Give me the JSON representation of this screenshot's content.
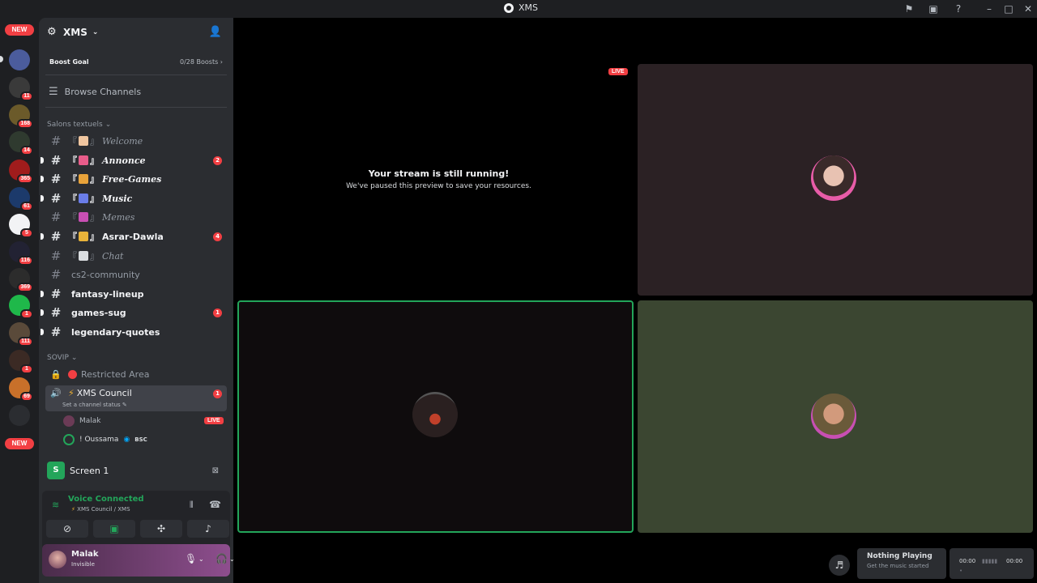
{
  "window": {
    "title": "XMS"
  },
  "rail": {
    "new_top": "NEW",
    "new_bottom": "NEW",
    "servers": [
      {
        "badge": "",
        "color": "#4b5c9c"
      },
      {
        "badge": "11",
        "color": "#3a3a3a"
      },
      {
        "badge": "168",
        "color": "#6b5a2a"
      },
      {
        "badge": "14",
        "color": "#2f3a2f"
      },
      {
        "badge": "365",
        "color": "#a01c1c"
      },
      {
        "badge": "61",
        "color": "#1c3a6b"
      },
      {
        "badge": "5",
        "color": "#f2f3f5"
      },
      {
        "badge": "116",
        "color": "#222233"
      },
      {
        "badge": "369",
        "color": "#2c2c2c"
      },
      {
        "badge": "1",
        "color": "#1fb84a"
      },
      {
        "badge": "111",
        "color": "#5a4a3a"
      },
      {
        "badge": "1",
        "color": "#3b2a24"
      },
      {
        "badge": "69",
        "color": "#c8702a"
      },
      {
        "badge": "",
        "color": "#2b2d31"
      }
    ]
  },
  "server": {
    "name": "XMS",
    "boost_label": "Boost Goal",
    "boost_count": "0/28 Boosts",
    "browse": "Browse Channels"
  },
  "categories": {
    "text": "Salons textuels",
    "sovip": "SOVIP"
  },
  "channels": [
    {
      "open": "『",
      "close": "』",
      "name": "Welcome",
      "fancy": true,
      "unread": false,
      "badge": "",
      "emoji_color": "#f0c6a0"
    },
    {
      "open": "『",
      "close": "』",
      "name": "Annonce",
      "fancy": true,
      "unread": true,
      "badge": "2",
      "emoji_color": "#e85c8a"
    },
    {
      "open": "『",
      "close": "』",
      "name": "Free-Games",
      "fancy": true,
      "unread": true,
      "badge": "",
      "emoji_color": "#e8a33a"
    },
    {
      "open": "『",
      "close": "』",
      "name": "Music",
      "fancy": true,
      "unread": true,
      "badge": "",
      "emoji_color": "#6a7de8"
    },
    {
      "open": "『",
      "close": "』",
      "name": "Memes",
      "fancy": true,
      "unread": false,
      "badge": "",
      "emoji_color": "#c84fb3"
    },
    {
      "open": "『",
      "close": "』",
      "name": "Asrar-Dawla",
      "fancy": false,
      "unread": true,
      "badge": "4",
      "emoji_color": "#e8b33a"
    },
    {
      "open": "『",
      "close": "』",
      "name": "Chat",
      "fancy": true,
      "unread": false,
      "badge": "",
      "emoji_color": "#dbdee1"
    },
    {
      "open": "",
      "close": "",
      "name": "cs2-community",
      "fancy": false,
      "unread": false,
      "badge": "",
      "emoji_color": ""
    },
    {
      "open": "",
      "close": "",
      "name": "fantasy-lineup",
      "fancy": false,
      "unread": true,
      "badge": "",
      "emoji_color": ""
    },
    {
      "open": "",
      "close": "",
      "name": "games-sug",
      "fancy": false,
      "unread": true,
      "badge": "1",
      "emoji_color": ""
    },
    {
      "open": "",
      "close": "",
      "name": "legendary-quotes",
      "fancy": false,
      "unread": true,
      "badge": "",
      "emoji_color": ""
    }
  ],
  "restricted": "Restricted Area",
  "voice_channel": {
    "name": "XMS Council",
    "badge": "1",
    "status": "Set a channel status",
    "users": [
      {
        "name": "Malak",
        "live": "LIVE"
      },
      {
        "name": "! Oussama",
        "tag": "BSC"
      }
    ]
  },
  "screen": {
    "icon": "S",
    "label": "Screen 1"
  },
  "voice": {
    "status": "Voice Connected",
    "location": "XMS Council / XMS"
  },
  "user": {
    "name": "Malak",
    "status": "Invisible"
  },
  "stage": {
    "paused_title": "Your stream is still running!",
    "paused_sub": "We've paused this preview to save your resources.",
    "live": "LIVE"
  },
  "player": {
    "title": "Nothing Playing",
    "sub": "Get the music started",
    "time_start": "00:00",
    "time_end": "00:00"
  }
}
